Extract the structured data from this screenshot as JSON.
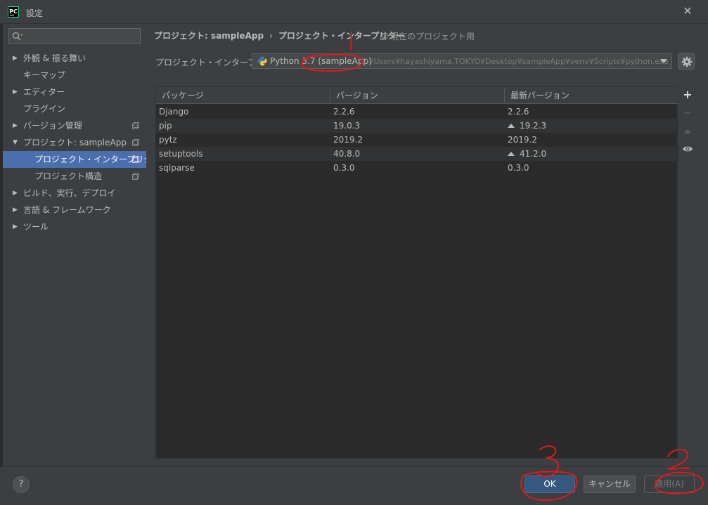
{
  "window": {
    "app_icon_text": "PC",
    "title": "設定",
    "close_icon": "close-icon"
  },
  "sidebar": {
    "search_placeholder": "",
    "items": [
      {
        "label": "外観 & 振る舞い",
        "expandable": true
      },
      {
        "label": "キーマップ",
        "expandable": false
      },
      {
        "label": "エディター",
        "expandable": true
      },
      {
        "label": "プラグイン",
        "expandable": false
      },
      {
        "label": "バージョン管理",
        "expandable": true
      },
      {
        "label": "プロジェクト: sampleApp",
        "expandable": true,
        "expanded": true
      },
      {
        "label": "プロジェクト・インタープリター",
        "selected": true
      },
      {
        "label": "プロジェクト構造"
      },
      {
        "label": "ビルド、実行、デプロイ",
        "expandable": true
      },
      {
        "label": "言語 & フレームワーク",
        "expandable": true
      },
      {
        "label": "ツール",
        "expandable": true
      }
    ]
  },
  "main": {
    "breadcrumb": {
      "project": "プロジェクト: sampleApp",
      "page": "プロジェクト・インタープリター",
      "separator": "›"
    },
    "current_project_note": "現在のプロジェクト用",
    "interpreter": {
      "label": "プロジェクト・インタープリター:",
      "name": "Python 3.7 (sampleApp)",
      "path": "C:¥Users¥hayashiyama.TOKYO¥Desktop¥sampleApp¥venv¥Scripts¥python.exe"
    },
    "table": {
      "headers": [
        "パッケージ",
        "バージョン",
        "最新バージョン"
      ],
      "rows": [
        {
          "package": "Django",
          "version": "2.2.6",
          "latest": "2.2.6",
          "upgrade": false
        },
        {
          "package": "pip",
          "version": "19.0.3",
          "latest": "19.2.3",
          "upgrade": true
        },
        {
          "package": "pytz",
          "version": "2019.2",
          "latest": "2019.2",
          "upgrade": false
        },
        {
          "package": "setuptools",
          "version": "40.8.0",
          "latest": "41.2.0",
          "upgrade": true
        },
        {
          "package": "sqlparse",
          "version": "0.3.0",
          "latest": "0.3.0",
          "upgrade": false
        }
      ]
    },
    "tools": {
      "add": "+",
      "remove": "−"
    }
  },
  "footer": {
    "help": "?",
    "ok": "OK",
    "cancel": "キャンセル",
    "apply": "適用(A)"
  },
  "annotations": {
    "mark_1": "1",
    "mark_2": "2",
    "mark_3": "3",
    "color": "#e0191c"
  }
}
